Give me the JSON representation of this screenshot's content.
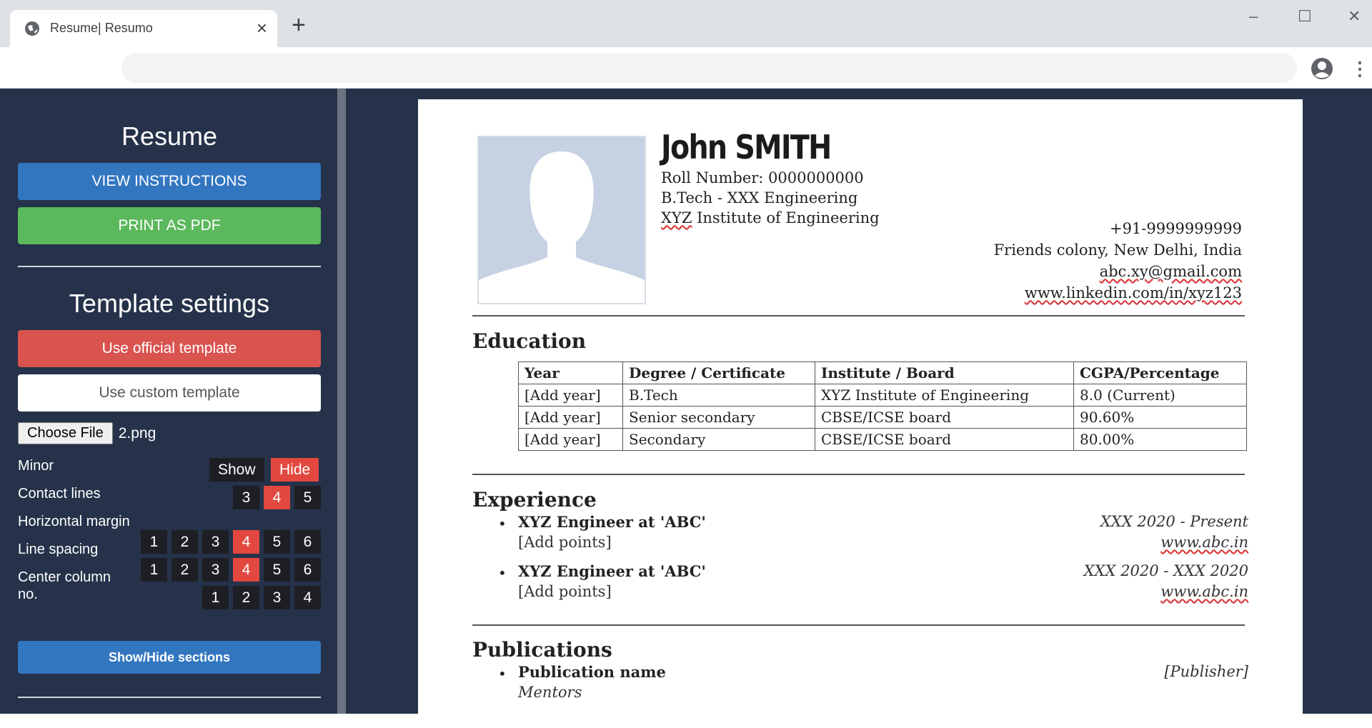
{
  "browser": {
    "tab_title": "Resume| Resumo",
    "new_tab": "+",
    "close_tab": "×",
    "minimize": "–",
    "maximize": "☐",
    "close_window": "✕"
  },
  "sidebar": {
    "title": "Resume",
    "view_instructions": "VIEW INSTRUCTIONS",
    "print_pdf": "PRINT AS PDF",
    "template_title": "Template settings",
    "official_template": "Use official template",
    "custom_template": "Use custom template",
    "choose_file": "Choose File",
    "file_name": "2.png",
    "minor_label": "Minor",
    "minor_show": "Show",
    "minor_hide": "Hide",
    "contact_lines_label": "Contact lines",
    "contact_lines_options": [
      "3",
      "4",
      "5"
    ],
    "contact_lines_selected": "4",
    "horizontal_margin_label": "Horizontal margin",
    "line_spacing_label": "Line spacing",
    "spacing_options": [
      "1",
      "2",
      "3",
      "4",
      "5",
      "6"
    ],
    "line_spacing_selected": "4",
    "center_column_label_1": "Center column",
    "center_column_label_2": "no.",
    "center_options": [
      "1",
      "2",
      "3",
      "4",
      "5",
      "6"
    ],
    "center_selected": "4",
    "column_no_options": [
      "1",
      "2",
      "3",
      "4"
    ],
    "show_hide_sections": "Show/Hide sections"
  },
  "resume": {
    "name": "John SMITH",
    "roll": "Roll Number: 0000000000",
    "degree": "B.Tech - XXX Engineering",
    "institute_xyz": "XYZ",
    "institute_rest": " Institute of Engineering",
    "phone": "+91-9999999999",
    "address": "Friends colony, New Delhi, India",
    "email": "abc.xy@gmail.com",
    "linkedin": "www.linkedin.com/in/xyz123",
    "education_title": "Education",
    "edu_headers": [
      "Year",
      "Degree / Certificate",
      "Institute / Board",
      "CGPA/Percentage"
    ],
    "edu_rows": [
      [
        "[Add year]",
        "B.Tech",
        "XYZ Institute of Engineering",
        "8.0 (Current)"
      ],
      [
        "[Add year]",
        "Senior secondary",
        "CBSE/ICSE board",
        "90.60%"
      ],
      [
        "[Add year]",
        "Secondary",
        "CBSE/ICSE board",
        "80.00%"
      ]
    ],
    "experience_title": "Experience",
    "experiences": [
      {
        "title": "XYZ Engineer at 'ABC'",
        "sub": "[Add points]",
        "date": "XXX 2020 - Present",
        "link": "www.abc.in"
      },
      {
        "title": "XYZ Engineer at 'ABC'",
        "sub": "[Add points]",
        "date": "XXX 2020 - XXX 2020",
        "link": "www.abc.in"
      }
    ],
    "publications_title": "Publications",
    "publication": {
      "title": "Publication name",
      "sub": "Mentors",
      "publisher": "[Publisher]"
    }
  }
}
